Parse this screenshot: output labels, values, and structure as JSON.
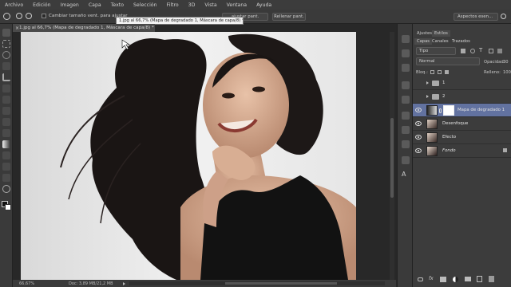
{
  "menu": [
    "Archivo",
    "Edición",
    "Imagen",
    "Capa",
    "Texto",
    "Selección",
    "Filtro",
    "3D",
    "Vista",
    "Ventana",
    "Ayuda"
  ],
  "options": {
    "checkbox_label": "Cambiar tamaño vent. para ajustar",
    "fit_button": "ajustar pant.",
    "fill_button": "Rellenar pant.",
    "workspace": "Aspectos esen...",
    "tooltip": "1.jpg al 66,7% (Mapa de degradado 1, Máscara de capa/8) *"
  },
  "doc_tab": "1.jpg al 66,7% (Mapa de degradado 1, Máscara de capa/8) *",
  "status": {
    "zoom": "66,67%",
    "doc": "Doc: 3,89 MB/21,2 MB"
  },
  "panels": {
    "top_tabs": [
      "Ajustes",
      "Estilos"
    ],
    "layer_tabs": [
      "Capas",
      "Canales",
      "Trazados"
    ],
    "kind": "Tipo",
    "blend": "Normal",
    "opacity_label": "Opacidad:",
    "opacity_value": "30",
    "lock_label": "Bloq.:",
    "fill_label": "Relleno:",
    "fill_value": "100"
  },
  "layers": [
    {
      "name": "1"
    },
    {
      "name": "2"
    },
    {
      "name": "Mapa de degradado 1"
    },
    {
      "name": "Desenfoque"
    },
    {
      "name": "Efecto"
    },
    {
      "name": "Fondo"
    }
  ],
  "colors": {
    "accent": "#6272a0",
    "bg": "#282828",
    "panel": "#3c3c3c"
  }
}
